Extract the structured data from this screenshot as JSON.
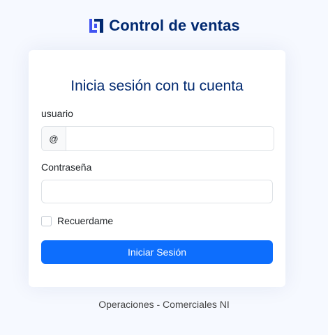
{
  "brand": {
    "name": "Control de ventas",
    "logo_icon": "brand-logo-icon",
    "color": "#012970",
    "accent": "#4154f1"
  },
  "login": {
    "title": "Inicia sesión con tu cuenta",
    "username": {
      "label": "usuario",
      "prefix": "@",
      "value": "",
      "placeholder": ""
    },
    "password": {
      "label": "Contraseña",
      "value": "",
      "placeholder": ""
    },
    "remember": {
      "label": "Recuerdame",
      "checked": false
    },
    "submit_label": "Iniciar Sesión",
    "primary_color": "#0d6efd"
  },
  "footer": {
    "text": "Operaciones - Comerciales NI"
  }
}
